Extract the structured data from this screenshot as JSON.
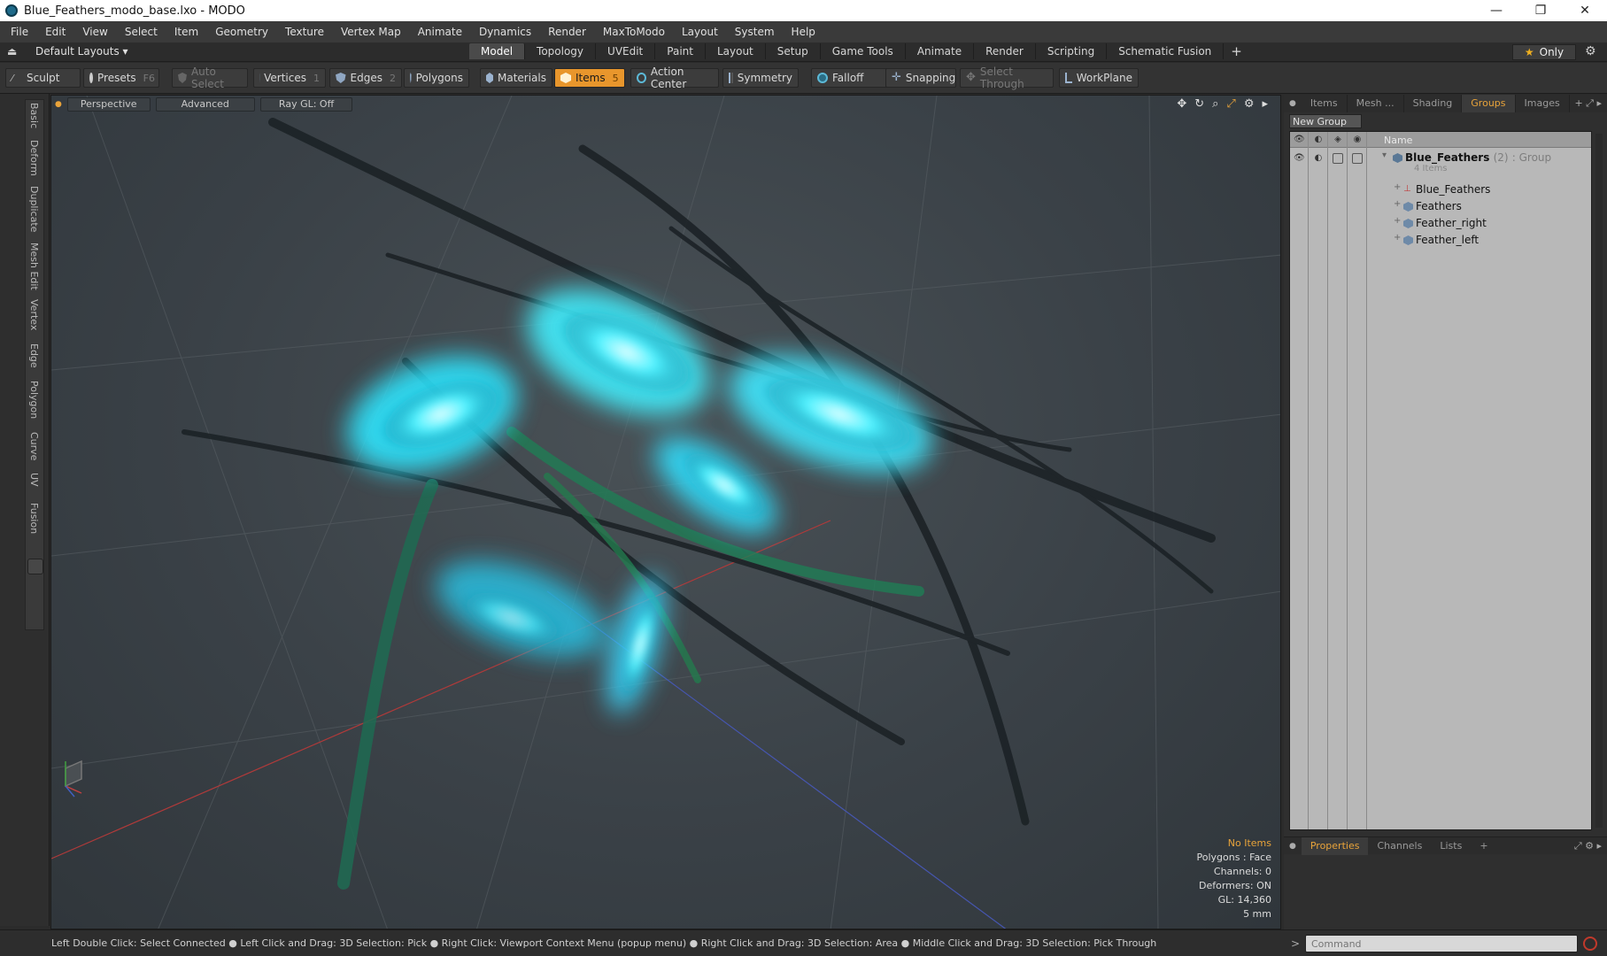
{
  "window": {
    "title": "Blue_Feathers_modo_base.lxo - MODO",
    "minimize": "—",
    "restore": "❐",
    "close": "✕"
  },
  "menu": [
    "File",
    "Edit",
    "View",
    "Select",
    "Item",
    "Geometry",
    "Texture",
    "Vertex Map",
    "Animate",
    "Dynamics",
    "Render",
    "MaxToModo",
    "Layout",
    "System",
    "Help"
  ],
  "layoutbar": {
    "layout_selector": "Default Layouts ▾",
    "tabs": [
      "Model",
      "Topology",
      "UVEdit",
      "Paint",
      "Layout",
      "Setup",
      "Game Tools",
      "Animate",
      "Render",
      "Scripting",
      "Schematic Fusion"
    ],
    "active_tab": "Model",
    "only_label": "Only"
  },
  "toolbar": {
    "sculpt": "Sculpt",
    "presets": "Presets",
    "presets_key": "F6",
    "auto_select": "Auto Select",
    "vertices": "Vertices",
    "vertices_key": "1",
    "edges": "Edges",
    "edges_key": "2",
    "polygons": "Polygons",
    "materials": "Materials",
    "items": "Items",
    "items_key": "5",
    "action_center": "Action Center",
    "symmetry": "Symmetry",
    "falloff": "Falloff",
    "snapping": "Snapping",
    "select_through": "Select Through",
    "workplane": "WorkPlane"
  },
  "left_tabs": [
    "Basic",
    "Deform",
    "Duplicate",
    "Mesh Edit",
    "Vertex",
    "Edge",
    "Polygon",
    "Curve",
    "UV",
    "Fusion"
  ],
  "viewport": {
    "view": "Perspective",
    "shading": "Advanced",
    "raygl": "Ray GL: Off",
    "info": {
      "no_items": "No Items",
      "polygons": "Polygons : Face",
      "channels": "Channels: 0",
      "deformers": "Deformers: ON",
      "gl": "GL: 14,360",
      "unit": "5 mm"
    }
  },
  "right_panel": {
    "tabs": [
      "Items",
      "Mesh ...",
      "Shading",
      "Groups",
      "Images"
    ],
    "active_tab": "Groups",
    "new_group": "New Group",
    "column_name": "Name",
    "group": {
      "name": "Blue_Feathers",
      "count": "(2)",
      "type": ": Group",
      "sub": "4 Items"
    },
    "children": [
      "Blue_Feathers",
      "Feathers",
      "Feather_right",
      "Feather_left"
    ],
    "bottom_tabs": [
      "Properties",
      "Channels",
      "Lists"
    ],
    "bottom_active": "Properties"
  },
  "statusbar": {
    "hint": "Left Double Click: Select Connected ● Left Click and Drag: 3D Selection: Pick ● Right Click: Viewport Context Menu (popup menu) ● Right Click and Drag: 3D Selection: Area ● Middle Click and Drag: 3D Selection: Pick Through",
    "command_prompt": ">",
    "command_placeholder": "Command"
  }
}
